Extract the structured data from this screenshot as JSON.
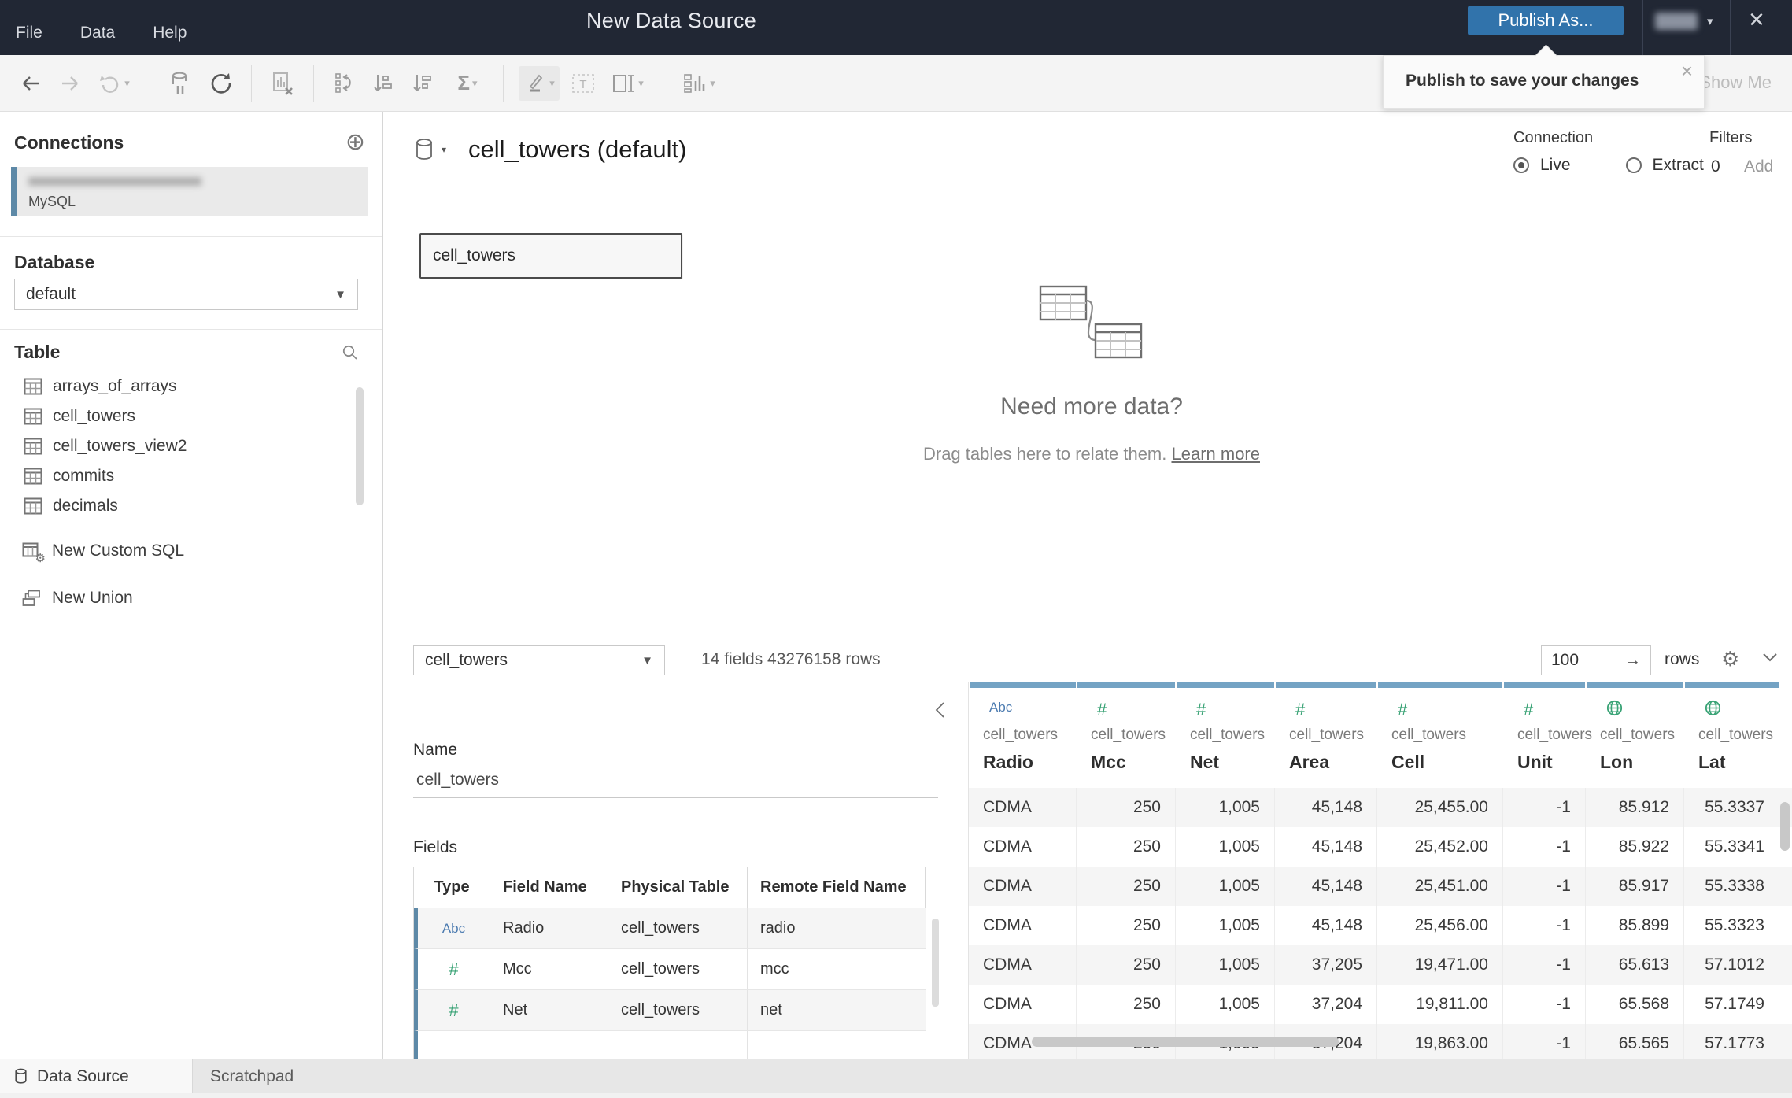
{
  "colors": {
    "titlebar_bg": "#212734",
    "publish_blue": "#3173ab",
    "grid_column_bar": "#74a3c4",
    "string_type_blue": "#4c7bb0",
    "number_type_green": "#3aa376",
    "connection_accent": "#5d89a7"
  },
  "titlebar": {
    "title": "New Data Source",
    "menus": [
      "File",
      "Data",
      "Help"
    ],
    "publish_label": "Publish As...",
    "user_caret": "▾",
    "close_glyph": "×"
  },
  "tooltip": {
    "text": "Publish to save your changes",
    "close_glyph": "×"
  },
  "toolbar": {
    "show_me": "Show Me",
    "totals_glyph": "Σ",
    "icons": [
      "undo",
      "redo",
      "replay",
      "pause-auto-updates",
      "refresh-data-source",
      "clear-sheet",
      "swap-rows-and-columns",
      "sort-ascending",
      "sort-descending",
      "totals",
      "highlight",
      "text-annotation",
      "fit-selector",
      "show-cards"
    ]
  },
  "sidebar": {
    "connections_title": "Connections",
    "add_glyph": "⊕",
    "connection": {
      "name_redacted": true,
      "type": "MySQL"
    },
    "database_label": "Database",
    "database_value": "default",
    "table_label": "Table",
    "tables": [
      "arrays_of_arrays",
      "cell_towers",
      "cell_towers_view2",
      "commits",
      "decimals"
    ],
    "actions": [
      {
        "label": "New Custom SQL"
      },
      {
        "label": "New Union"
      }
    ]
  },
  "canvas": {
    "datasource_title": "cell_towers (default)",
    "connection_label": "Connection",
    "live_label": "Live",
    "extract_label": "Extract",
    "filters_label": "Filters",
    "filters_count": "0",
    "filters_add_label": "Add",
    "node_label": "cell_towers",
    "empty_headline": "Need more data?",
    "empty_body": "Drag tables here to relate them. ",
    "empty_link": "Learn more"
  },
  "grid_bar": {
    "table_select_value": "cell_towers",
    "summary": "14 fields 43276158 rows",
    "rows_value": "100",
    "rows_go_glyph": "→",
    "rows_label": "rows",
    "gear_glyph": "⚙"
  },
  "metadata": {
    "name_label": "Name",
    "name_value": "cell_towers",
    "fields_label": "Fields",
    "columns": [
      "Type",
      "Field Name",
      "Physical Table",
      "Remote Field Name"
    ],
    "fields": [
      {
        "type": "string",
        "type_glyph": "Abc",
        "field_name": "Radio",
        "physical_table": "cell_towers",
        "remote_field": "radio"
      },
      {
        "type": "number",
        "type_glyph": "#",
        "field_name": "Mcc",
        "physical_table": "cell_towers",
        "remote_field": "mcc"
      },
      {
        "type": "number",
        "type_glyph": "#",
        "field_name": "Net",
        "physical_table": "cell_towers",
        "remote_field": "net"
      }
    ]
  },
  "grid": {
    "columns": [
      {
        "type": "string",
        "source": "cell_towers",
        "name": "Radio",
        "align": "left"
      },
      {
        "type": "number",
        "source": "cell_towers",
        "name": "Mcc",
        "align": "right"
      },
      {
        "type": "number",
        "source": "cell_towers",
        "name": "Net",
        "align": "right"
      },
      {
        "type": "number",
        "source": "cell_towers",
        "name": "Area",
        "align": "right"
      },
      {
        "type": "number",
        "source": "cell_towers",
        "name": "Cell",
        "align": "right"
      },
      {
        "type": "number",
        "source": "cell_towers",
        "name": "Unit",
        "align": "right"
      },
      {
        "type": "geo",
        "source": "cell_towers",
        "name": "Lon",
        "align": "right"
      },
      {
        "type": "geo",
        "source": "cell_towers",
        "name": "Lat",
        "align": "right"
      }
    ],
    "rows": [
      [
        "CDMA",
        "250",
        "1,005",
        "45,148",
        "25,455.00",
        "-1",
        "85.912",
        "55.3337"
      ],
      [
        "CDMA",
        "250",
        "1,005",
        "45,148",
        "25,452.00",
        "-1",
        "85.922",
        "55.3341"
      ],
      [
        "CDMA",
        "250",
        "1,005",
        "45,148",
        "25,451.00",
        "-1",
        "85.917",
        "55.3338"
      ],
      [
        "CDMA",
        "250",
        "1,005",
        "45,148",
        "25,456.00",
        "-1",
        "85.899",
        "55.3323"
      ],
      [
        "CDMA",
        "250",
        "1,005",
        "37,205",
        "19,471.00",
        "-1",
        "65.613",
        "57.1012"
      ],
      [
        "CDMA",
        "250",
        "1,005",
        "37,204",
        "19,811.00",
        "-1",
        "65.568",
        "57.1749"
      ],
      [
        "CDMA",
        "250",
        "1,005",
        "37,204",
        "19,863.00",
        "-1",
        "65.565",
        "57.1773"
      ]
    ]
  },
  "statusbar": {
    "tabs": [
      {
        "label": "Data Source",
        "active": true
      },
      {
        "label": "Scratchpad",
        "active": false
      }
    ]
  }
}
